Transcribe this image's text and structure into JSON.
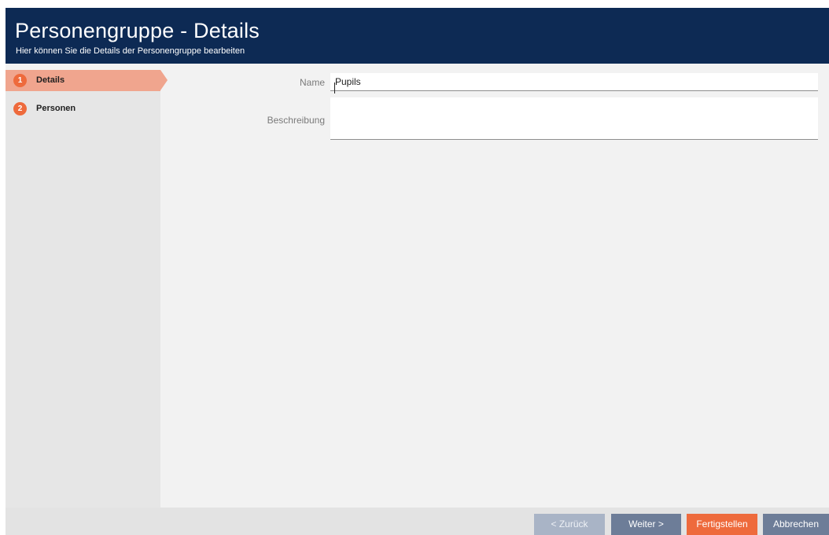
{
  "header": {
    "title": "Personengruppe - Details",
    "subtitle": "Hier können Sie die Details der Personengruppe bearbeiten"
  },
  "steps": [
    {
      "number": "1",
      "label": "Details",
      "active": true
    },
    {
      "number": "2",
      "label": "Personen",
      "active": false
    }
  ],
  "form": {
    "name_label": "Name",
    "name_value": "Pupils",
    "description_label": "Beschreibung",
    "description_value": ""
  },
  "footer": {
    "back_label": "< Zurück",
    "next_label": "Weiter >",
    "finish_label": "Fertigstellen",
    "cancel_label": "Abbrechen"
  },
  "colors": {
    "header_bg": "#0d2a54",
    "accent_orange": "#ee6a3c",
    "active_step_bg": "#f0a58e",
    "button_blue_gray": "#6d7d98"
  }
}
